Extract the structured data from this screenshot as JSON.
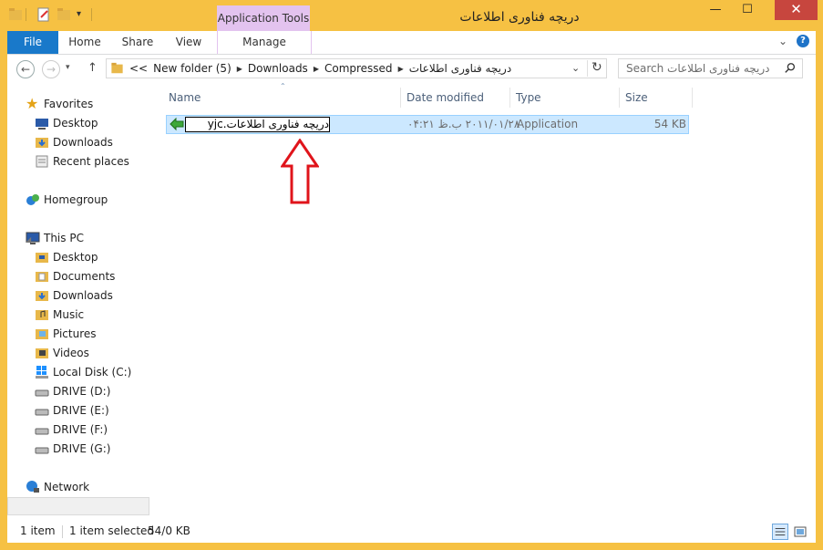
{
  "window": {
    "title": "دریچه فناوری اطلاعات",
    "context_tab": "Application Tools",
    "minimize": "—",
    "maximize": "☐",
    "close": "✕"
  },
  "ribbon": {
    "tabs": [
      "File",
      "Home",
      "Share",
      "View",
      "Manage"
    ],
    "help": "?"
  },
  "address": {
    "overflow": "<<",
    "crumbs": [
      "New folder (5)",
      "Downloads",
      "Compressed",
      "دریچه فناوری اطلاعات"
    ],
    "search_placeholder": "Search دریچه فناوری اطلاعات"
  },
  "nav": {
    "favorites": {
      "label": "Favorites",
      "items": [
        "Desktop",
        "Downloads",
        "Recent places"
      ]
    },
    "homegroup": "Homegroup",
    "this_pc": {
      "label": "This PC",
      "items": [
        "Desktop",
        "Documents",
        "Downloads",
        "Music",
        "Pictures",
        "Videos",
        "Local Disk (C:)",
        "DRIVE (D:)",
        "DRIVE (E:)",
        "DRIVE (F:)",
        "DRIVE (G:)"
      ]
    },
    "network": "Network"
  },
  "columns": {
    "name": "Name",
    "date": "Date modified",
    "type": "Type",
    "size": "Size"
  },
  "files": [
    {
      "name": "دریچه فناوری اطلاعات.yjc",
      "date": "۲۰۱۱/۰۱/۲۸ ب.ظ ۰۴:۲۱",
      "type": "Application",
      "size": "54 KB"
    }
  ],
  "status": {
    "count": "1 item",
    "selected": "1 item selected",
    "size": "54/0 KB"
  },
  "colors": {
    "frame": "#f6c143",
    "file_tab": "#1979ca",
    "context": "#e3c3ef",
    "selection": "#cce8ff",
    "close": "#c7463e",
    "arrow": "#e0141b"
  }
}
